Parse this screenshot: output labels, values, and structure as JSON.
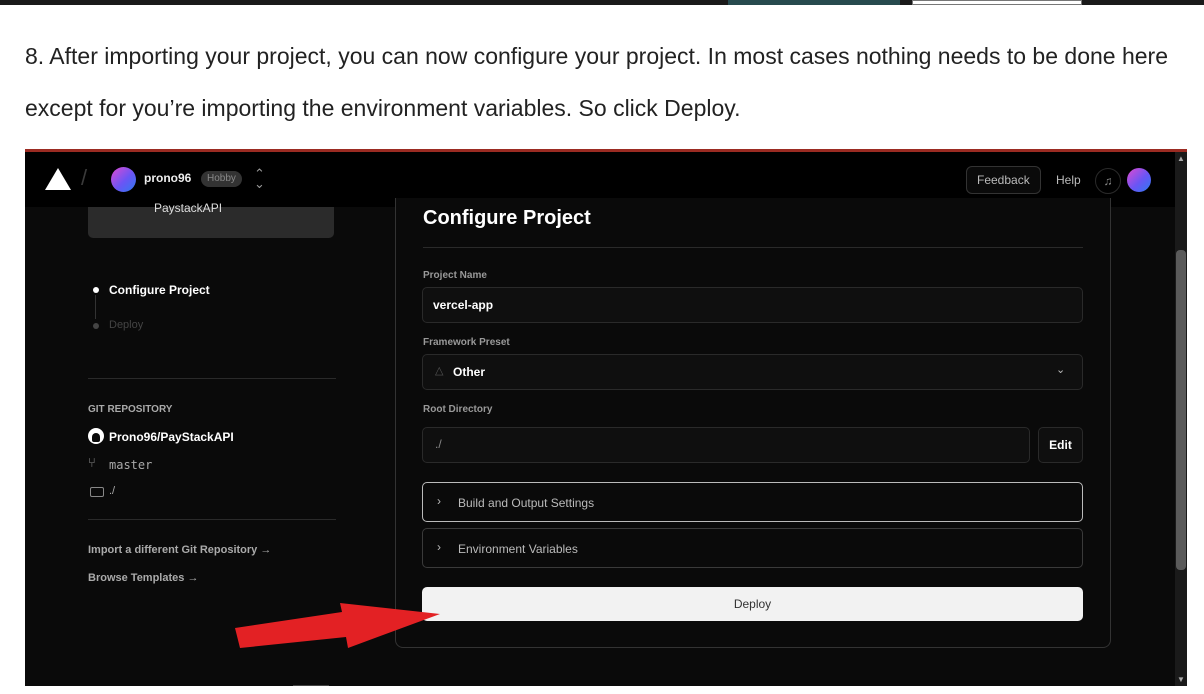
{
  "article": {
    "instruction": "8. After importing your project, you can now configure your project. In most cases nothing needs to be done here except for you’re importing the environment variables. So click Deploy."
  },
  "navbar": {
    "logo_icon": "vercel-triangle-icon",
    "username": "prono96",
    "plan_badge": "Hobby",
    "feedback_label": "Feedback",
    "help_label": "Help",
    "bell_icon": "bell-icon"
  },
  "sidebar": {
    "repo_card_text": "PaystackAPI",
    "steps": [
      {
        "label": "Configure Project",
        "active": true
      },
      {
        "label": "Deploy",
        "active": false
      }
    ],
    "git_heading": "GIT REPOSITORY",
    "repo_name": "Prono96/PayStackAPI",
    "branch": "master",
    "path": "./",
    "links": [
      "Import a different Git Repository →",
      "Browse Templates →"
    ]
  },
  "configure": {
    "title": "Configure Project",
    "project_name_label": "Project Name",
    "project_name_value": "vercel-app",
    "framework_label": "Framework Preset",
    "framework_value": "Other",
    "root_label": "Root Directory",
    "root_value": "./",
    "edit_label": "Edit",
    "build_settings_label": "Build and Output Settings",
    "env_vars_label": "Environment Variables",
    "deploy_label": "Deploy"
  },
  "colors": {
    "accent_arrow": "#e32124",
    "background": "#0a0a0a",
    "deploy_button": "#f2f2f2"
  }
}
